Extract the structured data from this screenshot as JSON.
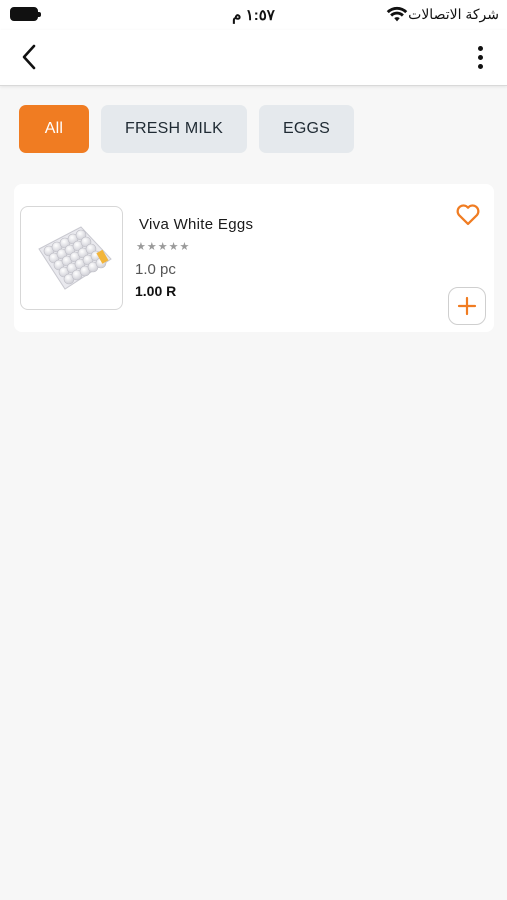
{
  "status_bar": {
    "time": "١:٥٧ م",
    "carrier": "شركة الاتصالات"
  },
  "filters": [
    {
      "label": "All",
      "active": true
    },
    {
      "label": "FRESH MILK",
      "active": false
    },
    {
      "label": "EGGS",
      "active": false
    }
  ],
  "product": {
    "name": "Viva White Eggs",
    "rating": "★★★★★",
    "unit": "1.0 pc",
    "price": "1.00 R"
  },
  "colors": {
    "accent": "#f07c22",
    "chip_bg": "#e5e9ed",
    "page_bg": "#f7f7f7"
  }
}
